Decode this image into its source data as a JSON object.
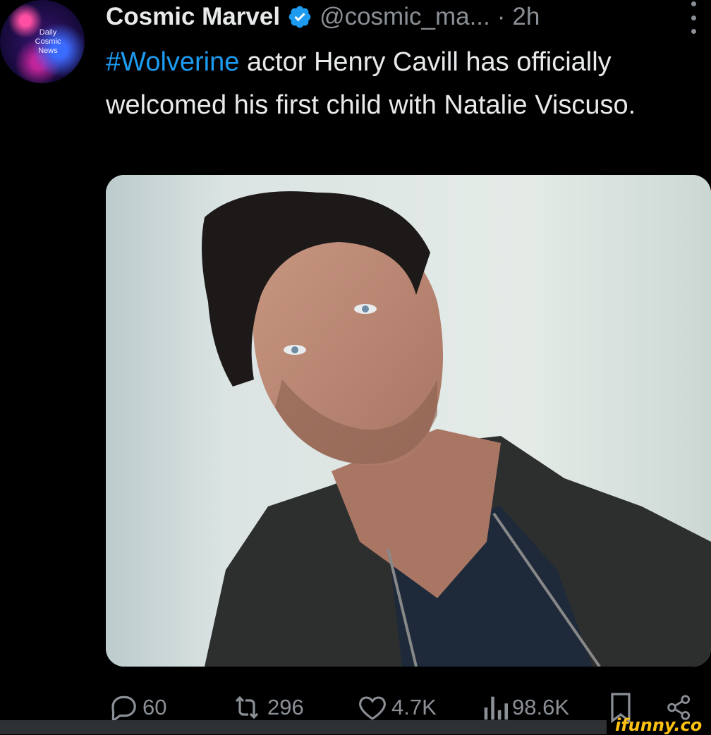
{
  "tweet": {
    "avatar_text": "Daily\nCosmic\nNews",
    "author_name": "Cosmic Marvel",
    "handle": "@cosmic_ma...",
    "separator": "·",
    "time": "2h",
    "text_hashtag": "#Wolverine",
    "text_rest": " actor Henry Cavill has officially welcomed his first child with Natalie Viscuso.",
    "media_icon": "photo",
    "verified_icon": "verified-badge-icon",
    "colors": {
      "link": "#1d9bf0",
      "muted": "#8b9096",
      "text": "#e7e9ea",
      "background": "#000000"
    }
  },
  "actions": {
    "reply_count": "60",
    "retweet_count": "296",
    "like_count": "4.7K",
    "view_count": "98.6K"
  },
  "watermark": "ifunny.co"
}
